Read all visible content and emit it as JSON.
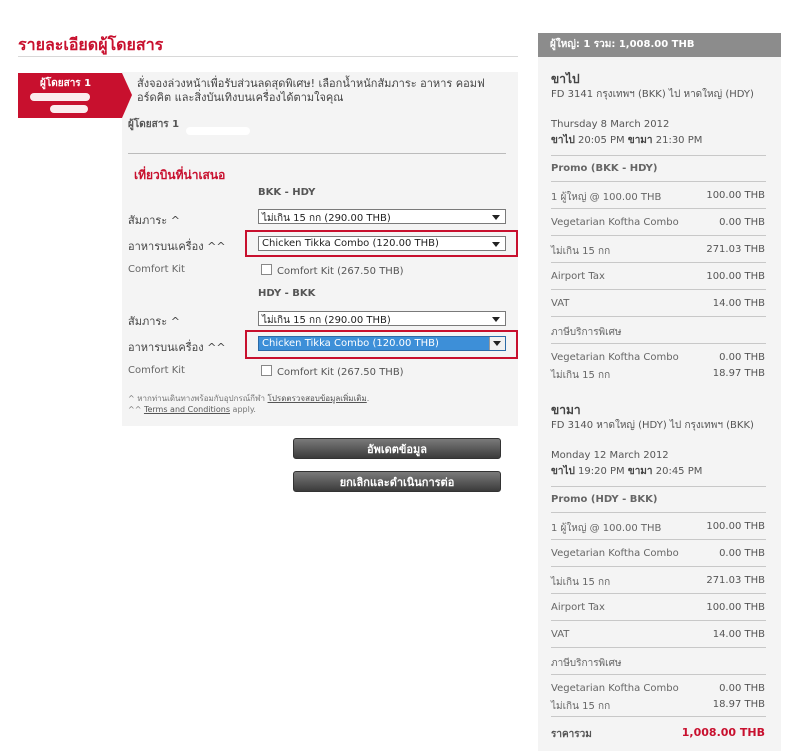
{
  "page_title": "รายละเอียดผู้โดยสาร",
  "passenger": {
    "tab_label": "ผู้โดยสาร 1",
    "promo_text": "สั่งจองล่วงหน้าเพื่อรับส่วนลดสุดพิเศษ! เลือกน้ำหนักสัมภาระ อาหาร คอมฟอร์ดคิต และสิ่งบันเทิงบนเครื่องได้ตามใจคุณ",
    "name_label": "ผู้โดยสาร 1"
  },
  "offers": {
    "title": "เที่ยวบินที่น่าเสนอ",
    "segments": [
      {
        "route": "BKK - HDY",
        "baggage_label": "สัมภาระ ^",
        "baggage_value": "ไม่เกิน 15 กก (290.00 THB)",
        "meal_label": "อาหารบนเครื่อง ^^",
        "meal_value": "Chicken Tikka Combo (120.00 THB)",
        "comfort_label": "Comfort Kit",
        "comfort_option": "Comfort Kit (267.50 THB)"
      },
      {
        "route": "HDY - BKK",
        "baggage_label": "สัมภาระ ^",
        "baggage_value": "ไม่เกิน 15 กก (290.00 THB)",
        "meal_label": "อาหารบนเครื่อง ^^",
        "meal_value": "Chicken Tikka Combo (120.00 THB)",
        "comfort_label": "Comfort Kit",
        "comfort_option": "Comfort Kit (267.50 THB)"
      }
    ],
    "footnote1_prefix": "^ หากท่านเดินทางพร้อมกับอุปกรณ์กีฬา",
    "footnote1_link": "โปรดตรวจสอบข้อมูลเพิ่มเติม",
    "footnote1_suffix": ".",
    "footnote2_prefix": "^^",
    "footnote2_link": "Terms and Conditions",
    "footnote2_suffix": "apply."
  },
  "buttons": {
    "update": "อัพเดตข้อมูล",
    "cancel_continue": "ยกเลิกและดำเนินการต่อ"
  },
  "summary": {
    "header": "ผู้ใหญ่: 1  รวม: 1,008.00 THB",
    "legs": [
      {
        "title": "ขาไป",
        "flight": "FD 3141 กรุงเทพฯ (BKK) ไป หาดใหญ่ (HDY)",
        "date": "Thursday 8 March 2012",
        "depart_label": "ขาไป",
        "depart_time": "20:05 PM",
        "arrive_label": "ขามา",
        "arrive_time": "21:30 PM",
        "fare_title": "Promo (BKK - HDY)",
        "items": [
          {
            "label": "1 ผู้ใหญ่ @ 100.00 THB",
            "amount": "100.00 THB"
          },
          {
            "label": "Vegetarian Koftha Combo",
            "amount": "0.00 THB"
          },
          {
            "label": "ไม่เกิน 15 กก",
            "amount": "271.03 THB"
          },
          {
            "label": "Airport Tax",
            "amount": "100.00 THB"
          },
          {
            "label": "VAT",
            "amount": "14.00 THB"
          }
        ],
        "extra_title": "ภาษีบริการพิเศษ",
        "extras": [
          {
            "label": "Vegetarian Koftha Combo",
            "amount": "0.00 THB"
          },
          {
            "label": "ไม่เกิน 15 กก",
            "amount": "18.97 THB"
          }
        ]
      },
      {
        "title": "ขามา",
        "flight": "FD 3140 หาดใหญ่ (HDY) ไป กรุงเทพฯ (BKK)",
        "date": "Monday 12 March 2012",
        "depart_label": "ขาไป",
        "depart_time": "19:20 PM",
        "arrive_label": "ขามา",
        "arrive_time": "20:45 PM",
        "fare_title": "Promo (HDY - BKK)",
        "items": [
          {
            "label": "1 ผู้ใหญ่ @ 100.00 THB",
            "amount": "100.00 THB"
          },
          {
            "label": "Vegetarian Koftha Combo",
            "amount": "0.00 THB"
          },
          {
            "label": "ไม่เกิน 15 กก",
            "amount": "271.03 THB"
          },
          {
            "label": "Airport Tax",
            "amount": "100.00 THB"
          },
          {
            "label": "VAT",
            "amount": "14.00 THB"
          }
        ],
        "extra_title": "ภาษีบริการพิเศษ",
        "extras": [
          {
            "label": "Vegetarian Koftha Combo",
            "amount": "0.00 THB"
          },
          {
            "label": "ไม่เกิน 15 กก",
            "amount": "18.97 THB"
          }
        ]
      }
    ],
    "total_label": "ราคารวม",
    "total_amount": "1,008.00 THB"
  },
  "colors": {
    "accent": "#c8102e",
    "panel": "#f4f4f4",
    "header_bar": "#8c8c8c",
    "select_highlight": "#3d8fd8"
  }
}
